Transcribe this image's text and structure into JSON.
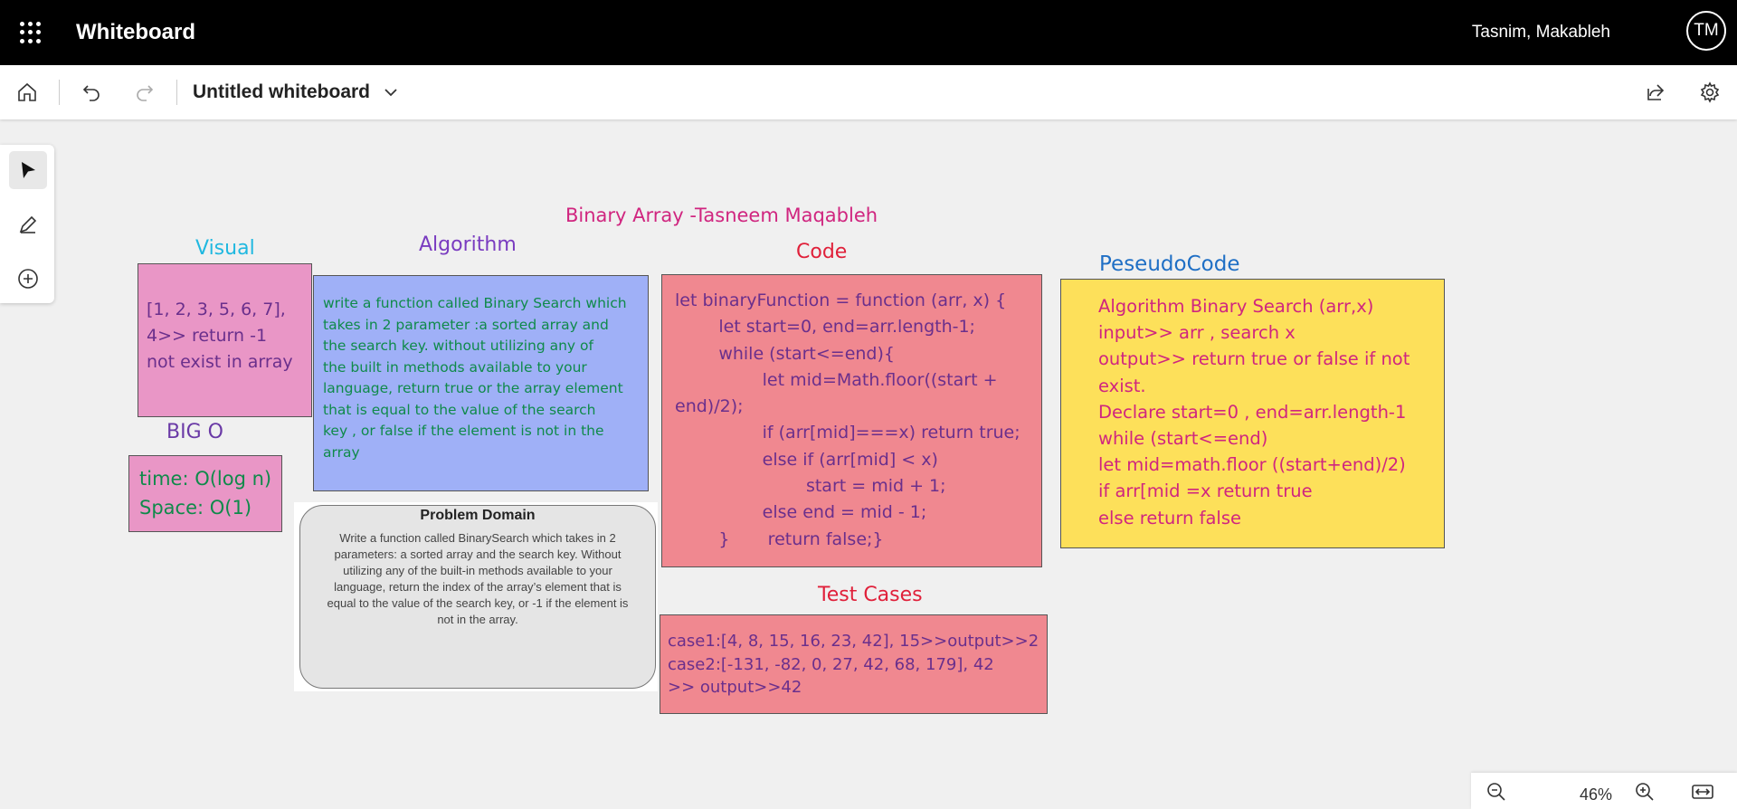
{
  "app": {
    "title": "Whiteboard",
    "user_name": "Tasnim, Makableh",
    "avatar_initials": "TM"
  },
  "toolbar": {
    "board_title": "Untitled whiteboard"
  },
  "board": {
    "main_title": "Binary Array -Tasneem Maqableh",
    "visual": {
      "label": "Visual",
      "lines": [
        "[1, 2, 3, 5, 6, 7],",
        "4>> return -1",
        "not exist in array"
      ]
    },
    "algorithm": {
      "label": "Algorithm",
      "lines": [
        "write a function called Binary Search which",
        "takes in 2 parameter :a sorted array and",
        "the search key. without utilizing any of",
        "the built in methods available to your",
        "language, return true or the array element",
        "that is equal to the value of the search",
        "key , or false if the element is not in the",
        "array"
      ]
    },
    "code": {
      "label": "Code",
      "lines": [
        "let binaryFunction = function (arr, x) {",
        "        let start=0, end=arr.length-1;",
        "        while (start<=end){",
        "                let mid=Math.floor((start +",
        "end)/2);",
        "                if (arr[mid]===x) return true;",
        "                else if (arr[mid] < x)",
        "                        start = mid + 1;",
        "                else end = mid - 1;",
        "        }       return false;}"
      ]
    },
    "pseudocode": {
      "label": "PeseudoCode",
      "lines": [
        "Algorithm Binary Search (arr,x)",
        "input>> arr , search x",
        "output>> return true or false if not",
        "exist.",
        "Declare start=0 , end=arr.length-1",
        "while (start<=end)",
        "let mid=math.floor ((start+end)/2)",
        "if arr[mid =x return true",
        "else return false"
      ]
    },
    "big_o": {
      "label": "BIG O",
      "lines": [
        "time: O(log n)",
        "Space: O(1)"
      ]
    },
    "problem_domain": {
      "title": "Problem Domain",
      "lines": [
        "Write a function called BinarySearch which takes in 2",
        "parameters: a sorted array and the search key. Without",
        "utilizing any of the built-in methods available to your",
        "language, return the index of the array’s element that is",
        "equal to the value of the search key, or -1 if the element is",
        "not in the array."
      ]
    },
    "test_cases": {
      "label": "Test Cases",
      "lines": [
        "case1:[4, 8, 15, 16, 23, 42], 15>>output>>2",
        "case2:[-131, -82, 0, 27, 42, 68, 179], 42",
        ">> output>>42"
      ]
    }
  },
  "zoom": {
    "value": "46%"
  },
  "colors": {
    "pink_note": "#e996c6",
    "blue_note": "#9fb0f7",
    "red_note": "#f08890",
    "yellow_note": "#fde05a",
    "gray_note": "#e5e5e5"
  }
}
